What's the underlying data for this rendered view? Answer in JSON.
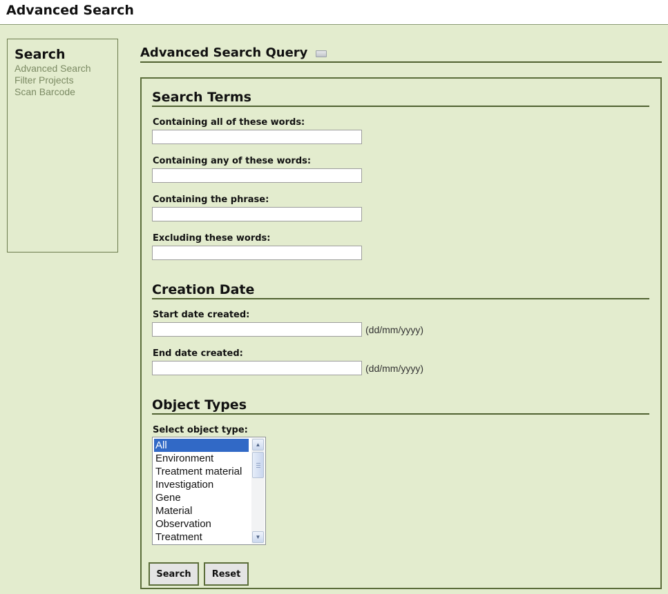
{
  "header": {
    "title": "Advanced Search"
  },
  "sidebar": {
    "title": "Search",
    "links": [
      "Advanced Search",
      "Filter Projects",
      "Scan Barcode"
    ]
  },
  "main": {
    "heading": "Advanced Search Query",
    "sections": {
      "search_terms": {
        "title": "Search Terms",
        "fields": [
          {
            "label": "Containing all of these words:",
            "value": ""
          },
          {
            "label": "Containing any of these words:",
            "value": ""
          },
          {
            "label": "Containing the phrase:",
            "value": ""
          },
          {
            "label": "Excluding these words:",
            "value": ""
          }
        ]
      },
      "creation_date": {
        "title": "Creation Date",
        "start_label": "Start date created:",
        "start_value": "",
        "end_label": "End date created:",
        "end_value": "",
        "date_format_hint": "(dd/mm/yyyy)"
      },
      "object_types": {
        "title": "Object Types",
        "select_label": "Select object type:",
        "options": [
          "All",
          "Environment",
          "Treatment material",
          "Investigation",
          "Gene",
          "Material",
          "Observation",
          "Treatment"
        ],
        "selected": "All"
      }
    },
    "buttons": {
      "search": "Search",
      "reset": "Reset"
    }
  },
  "colors": {
    "background": "#e3ecce",
    "border": "#5b6d3a",
    "link": "#7b8a63",
    "selection": "#3169c6"
  }
}
